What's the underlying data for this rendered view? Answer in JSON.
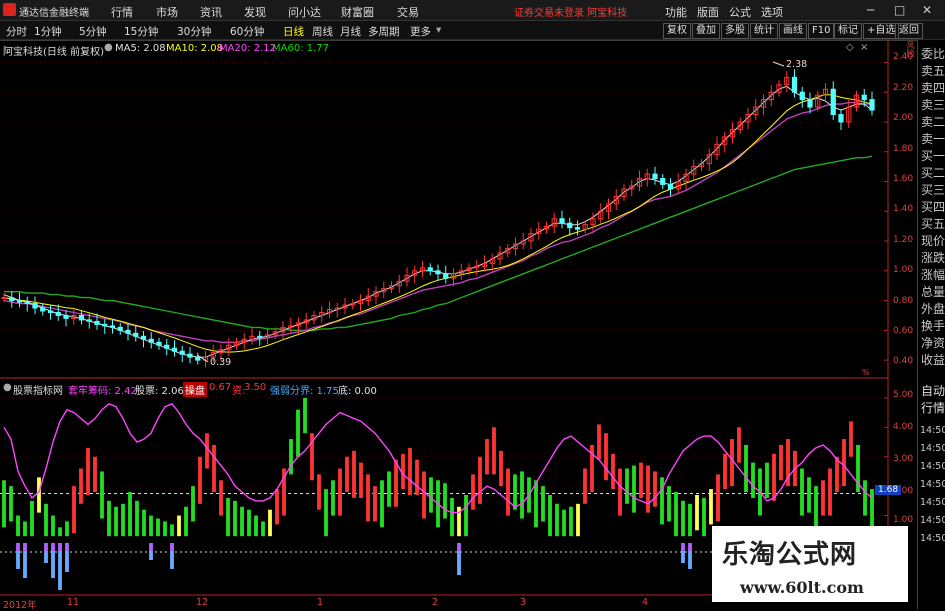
{
  "menubar": {
    "app_title": "通达信金融终端",
    "items": [
      "行情",
      "市场",
      "资讯",
      "发现",
      "问小达",
      "财富圈",
      "交易"
    ],
    "warning": "证券交易未登录  阿宝科技",
    "right_items": [
      "功能",
      "版面",
      "公式",
      "选项"
    ],
    "win_controls": [
      "─",
      "□",
      "✕"
    ]
  },
  "toolbar": {
    "timeframes": [
      "分时",
      "1分钟",
      "5分钟",
      "15分钟",
      "30分钟",
      "60分钟",
      "日线",
      "周线",
      "月线",
      "多周期",
      "更多"
    ],
    "active_timeframe": "日线",
    "right_buttons": [
      "复权",
      "叠加",
      "多股",
      "统计",
      "画线",
      "F10",
      "标记",
      "+自选",
      "返回"
    ]
  },
  "main_chart": {
    "stock_label": "阿宝科技(日线 前复权)",
    "ma": [
      {
        "label": "MA5: 2.08",
        "color": "#e0e0e0"
      },
      {
        "label": "MA10: 2.08",
        "color": "#ffff00"
      },
      {
        "label": "MA20: 2.12",
        "color": "#ff44ff"
      },
      {
        "label": "MA60: 1.77",
        "color": "#00dd00"
      }
    ],
    "high_annotation": "2.38",
    "low_annotation": "0.39",
    "y_ticks": [
      "2.40",
      "2.20",
      "2.00",
      "1.80",
      "1.60",
      "1.40",
      "1.20",
      "1.00",
      "0.80",
      "0.60",
      "0.40"
    ],
    "top_right_label": "风险",
    "scale_label": "%"
  },
  "chart_data": {
    "type": "candlestick",
    "ylim": [
      0.3,
      2.45
    ],
    "close_series": [
      0.82,
      0.8,
      0.79,
      0.78,
      0.75,
      0.73,
      0.72,
      0.7,
      0.68,
      0.7,
      0.67,
      0.66,
      0.64,
      0.63,
      0.62,
      0.6,
      0.58,
      0.56,
      0.54,
      0.52,
      0.5,
      0.48,
      0.46,
      0.44,
      0.42,
      0.4,
      0.42,
      0.45,
      0.47,
      0.5,
      0.52,
      0.54,
      0.56,
      0.55,
      0.57,
      0.59,
      0.62,
      0.63,
      0.65,
      0.67,
      0.7,
      0.72,
      0.74,
      0.75,
      0.77,
      0.78,
      0.8,
      0.83,
      0.86,
      0.88,
      0.9,
      0.93,
      0.97,
      1.0,
      1.02,
      1.0,
      0.98,
      0.95,
      0.98,
      1.0,
      1.02,
      1.03,
      1.05,
      1.08,
      1.12,
      1.15,
      1.18,
      1.2,
      1.25,
      1.28,
      1.3,
      1.35,
      1.32,
      1.29,
      1.28,
      1.31,
      1.35,
      1.4,
      1.45,
      1.5,
      1.55,
      1.57,
      1.62,
      1.65,
      1.62,
      1.58,
      1.55,
      1.6,
      1.65,
      1.7,
      1.72,
      1.78,
      1.85,
      1.9,
      1.95,
      2.0,
      2.05,
      2.1,
      2.15,
      2.2,
      2.25,
      2.3,
      2.2,
      2.15,
      2.1,
      2.18,
      2.22,
      2.05,
      2.0,
      2.1,
      2.18,
      2.15,
      2.08
    ],
    "ma5": [
      0.84,
      0.82,
      0.8,
      0.79,
      0.77,
      0.75,
      0.73,
      0.71,
      0.7,
      0.69,
      0.68,
      0.66,
      0.65,
      0.63,
      0.62,
      0.6,
      0.58,
      0.56,
      0.54,
      0.52,
      0.5,
      0.48,
      0.46,
      0.44,
      0.43,
      0.42,
      0.42,
      0.44,
      0.46,
      0.48,
      0.5,
      0.52,
      0.54,
      0.55,
      0.56,
      0.58,
      0.6,
      0.62,
      0.64,
      0.66,
      0.68,
      0.7,
      0.72,
      0.74,
      0.76,
      0.78,
      0.8,
      0.82,
      0.85,
      0.87,
      0.89,
      0.92,
      0.95,
      0.98,
      1.0,
      1.0,
      0.99,
      0.98,
      0.98,
      0.99,
      1.01,
      1.03,
      1.05,
      1.08,
      1.11,
      1.14,
      1.17,
      1.2,
      1.23,
      1.26,
      1.29,
      1.32,
      1.32,
      1.31,
      1.31,
      1.33,
      1.36,
      1.4,
      1.44,
      1.48,
      1.53,
      1.56,
      1.6,
      1.62,
      1.61,
      1.59,
      1.58,
      1.6,
      1.64,
      1.68,
      1.72,
      1.77,
      1.82,
      1.88,
      1.93,
      1.98,
      2.03,
      2.08,
      2.13,
      2.18,
      2.22,
      2.24,
      2.2,
      2.17,
      2.15,
      2.16,
      2.14,
      2.1,
      2.08,
      2.1,
      2.12,
      2.12,
      2.08
    ],
    "ma20": [
      0.8,
      0.79,
      0.78,
      0.78,
      0.77,
      0.76,
      0.75,
      0.74,
      0.73,
      0.72,
      0.71,
      0.7,
      0.69,
      0.68,
      0.67,
      0.66,
      0.64,
      0.63,
      0.62,
      0.6,
      0.59,
      0.58,
      0.57,
      0.56,
      0.55,
      0.54,
      0.53,
      0.53,
      0.52,
      0.52,
      0.52,
      0.53,
      0.53,
      0.54,
      0.55,
      0.56,
      0.57,
      0.58,
      0.59,
      0.6,
      0.62,
      0.63,
      0.65,
      0.66,
      0.68,
      0.7,
      0.71,
      0.73,
      0.75,
      0.77,
      0.79,
      0.81,
      0.83,
      0.85,
      0.87,
      0.88,
      0.89,
      0.9,
      0.91,
      0.92,
      0.94,
      0.95,
      0.97,
      0.99,
      1.01,
      1.03,
      1.05,
      1.07,
      1.1,
      1.12,
      1.15,
      1.17,
      1.19,
      1.2,
      1.22,
      1.24,
      1.26,
      1.29,
      1.31,
      1.34,
      1.37,
      1.4,
      1.43,
      1.46,
      1.48,
      1.49,
      1.5,
      1.52,
      1.54,
      1.57,
      1.6,
      1.63,
      1.66,
      1.7,
      1.74,
      1.78,
      1.82,
      1.86,
      1.9,
      1.94,
      1.98,
      2.02,
      2.04,
      2.06,
      2.07,
      2.09,
      2.11,
      2.12,
      2.12,
      2.13,
      2.13,
      2.12,
      2.12
    ],
    "ma60": [
      0.86,
      0.86,
      0.86,
      0.85,
      0.85,
      0.85,
      0.84,
      0.84,
      0.83,
      0.83,
      0.82,
      0.82,
      0.81,
      0.8,
      0.8,
      0.79,
      0.78,
      0.77,
      0.76,
      0.75,
      0.74,
      0.73,
      0.72,
      0.71,
      0.7,
      0.69,
      0.68,
      0.67,
      0.66,
      0.65,
      0.64,
      0.63,
      0.62,
      0.62,
      0.61,
      0.61,
      0.61,
      0.6,
      0.6,
      0.6,
      0.6,
      0.61,
      0.61,
      0.62,
      0.62,
      0.63,
      0.64,
      0.65,
      0.66,
      0.67,
      0.68,
      0.7,
      0.71,
      0.72,
      0.74,
      0.75,
      0.77,
      0.78,
      0.8,
      0.82,
      0.84,
      0.86,
      0.88,
      0.9,
      0.92,
      0.94,
      0.96,
      0.98,
      1.0,
      1.02,
      1.04,
      1.06,
      1.08,
      1.1,
      1.12,
      1.14,
      1.16,
      1.18,
      1.2,
      1.22,
      1.24,
      1.26,
      1.28,
      1.3,
      1.32,
      1.34,
      1.36,
      1.38,
      1.4,
      1.42,
      1.44,
      1.46,
      1.48,
      1.5,
      1.52,
      1.54,
      1.56,
      1.58,
      1.6,
      1.62,
      1.64,
      1.66,
      1.68,
      1.69,
      1.7,
      1.71,
      1.72,
      1.73,
      1.74,
      1.75,
      1.76,
      1.76,
      1.77
    ]
  },
  "indicator": {
    "name": "股票指标网",
    "items": [
      {
        "label": "套牢筹码: 2.42",
        "color": "#ff44ff"
      },
      {
        "label": "股票: 2.06",
        "color": "#e0e0e0"
      },
      {
        "label": "操盘",
        "color": "#ff3333"
      },
      {
        "label": "0.67",
        "color": "#ff3333"
      },
      {
        "label": "资:",
        "color": "#ff3333"
      },
      {
        "label": "3.50",
        "color": "#ff3333"
      },
      {
        "label": "强弱分界: 1.75",
        "color": "#44aaff"
      },
      {
        "label": "底: 0.00",
        "color": "#e0e0e0"
      }
    ],
    "y_ticks": [
      "5.00",
      "4.00",
      "3.00",
      "2.00",
      "1.00"
    ],
    "current_value": "1.68",
    "hist": [
      2.2,
      2.0,
      1.0,
      0.8,
      1.5,
      2.3,
      1.4,
      1.0,
      0.6,
      0.8,
      2.0,
      2.6,
      3.3,
      3.0,
      2.5,
      1.5,
      1.3,
      1.4,
      1.8,
      1.5,
      1.2,
      1.0,
      0.9,
      0.8,
      0.7,
      1.0,
      1.3,
      2.0,
      3.0,
      3.8,
      3.4,
      2.2,
      1.6,
      1.5,
      1.3,
      1.2,
      1.0,
      0.8,
      1.2,
      1.9,
      2.6,
      3.6,
      4.6,
      5.0,
      3.8,
      2.4,
      1.9,
      2.2,
      2.6,
      3.0,
      3.2,
      2.8,
      2.4,
      2.0,
      2.2,
      2.5,
      2.9,
      3.1,
      3.3,
      2.9,
      2.5,
      2.3,
      2.2,
      2.1,
      1.6,
      1.3,
      1.7,
      2.4,
      3.0,
      3.6,
      4.0,
      3.2,
      2.6,
      2.4,
      2.5,
      2.3,
      2.2,
      2.0,
      1.7,
      1.4,
      1.2,
      1.3,
      1.4,
      2.6,
      3.4,
      4.1,
      3.8,
      3.1,
      2.6,
      2.6,
      2.7,
      2.8,
      2.7,
      2.5,
      2.3,
      2.0,
      1.8,
      1.5,
      1.4,
      1.7,
      1.6,
      1.9,
      2.4,
      3.1,
      3.6,
      4.0,
      3.4,
      2.8,
      2.6,
      2.8,
      3.1,
      3.4,
      3.6,
      3.2,
      2.6,
      2.3,
      2.0,
      2.2,
      2.6,
      3.0,
      3.6,
      4.2,
      3.4,
      2.2,
      1.9
    ],
    "hist_color": [
      "g",
      "g",
      "g",
      "g",
      "g",
      "y",
      "g",
      "g",
      "g",
      "g",
      "r",
      "r",
      "r",
      "r",
      "g",
      "g",
      "g",
      "g",
      "g",
      "g",
      "g",
      "g",
      "g",
      "g",
      "g",
      "y",
      "g",
      "g",
      "r",
      "r",
      "r",
      "r",
      "g",
      "g",
      "g",
      "g",
      "g",
      "g",
      "y",
      "r",
      "r",
      "g",
      "g",
      "g",
      "r",
      "r",
      "g",
      "g",
      "r",
      "r",
      "r",
      "r",
      "r",
      "r",
      "g",
      "g",
      "r",
      "r",
      "r",
      "r",
      "r",
      "g",
      "g",
      "g",
      "g",
      "y",
      "g",
      "r",
      "r",
      "r",
      "r",
      "r",
      "r",
      "g",
      "g",
      "g",
      "g",
      "g",
      "g",
      "g",
      "g",
      "g",
      "y",
      "r",
      "r",
      "r",
      "r",
      "r",
      "r",
      "g",
      "g",
      "r",
      "r",
      "r",
      "g",
      "g",
      "g",
      "g",
      "g",
      "y",
      "g",
      "y",
      "r",
      "r",
      "r",
      "r",
      "g",
      "g",
      "g",
      "g",
      "r",
      "r",
      "r",
      "r",
      "g",
      "g",
      "g",
      "r",
      "r",
      "r",
      "r",
      "r",
      "g",
      "g",
      "g"
    ],
    "blue_ext": [
      0,
      0,
      0.6,
      0.9,
      0,
      0,
      0.4,
      0.9,
      1.3,
      0.7,
      0,
      0,
      0,
      0,
      0,
      0,
      0,
      0,
      0,
      0,
      0,
      0.3,
      0,
      0,
      0.6,
      0,
      0,
      0,
      0,
      0,
      0,
      0,
      0,
      0,
      0,
      0,
      0,
      0,
      0,
      0,
      0,
      0,
      0,
      0,
      0,
      0,
      0,
      0,
      0,
      0,
      0,
      0,
      0,
      0,
      0,
      0,
      0,
      0,
      0,
      0,
      0,
      0,
      0,
      0,
      0,
      0.8,
      0,
      0,
      0,
      0,
      0,
      0,
      0,
      0,
      0,
      0,
      0,
      0,
      0,
      0,
      0,
      0,
      0,
      0,
      0,
      0,
      0,
      0,
      0,
      0,
      0,
      0,
      0,
      0,
      0,
      0,
      0,
      0.4,
      0.6,
      0,
      0,
      0,
      0,
      0,
      0,
      0,
      0,
      0,
      0,
      0,
      0,
      0,
      0,
      0,
      0,
      0,
      0,
      0,
      0,
      0,
      0,
      0,
      0
    ],
    "magenta_line": [
      4.0,
      3.6,
      2.5,
      2.0,
      1.6,
      1.8,
      2.6,
      3.5,
      4.2,
      4.6,
      4.5,
      4.3,
      4.1,
      4.3,
      4.6,
      4.8,
      4.7,
      4.3,
      3.8,
      3.5,
      3.6,
      3.8,
      4.3,
      4.7,
      4.8,
      4.5,
      4.1,
      3.8,
      3.6,
      3.3,
      3.0,
      2.7,
      2.4,
      2.0,
      1.8,
      1.6,
      1.5,
      1.5,
      1.6,
      1.9,
      2.3,
      2.7,
      3.0,
      3.2,
      3.5,
      3.8,
      4.1,
      4.3,
      4.5,
      4.4,
      4.3,
      4.2,
      4.0,
      3.8,
      3.5,
      3.2,
      2.8,
      2.4,
      2.2,
      2.0,
      1.8,
      1.6,
      1.4,
      1.2,
      1.1,
      1.1,
      1.3,
      1.6,
      1.8,
      2.0,
      1.9,
      1.7,
      1.5,
      1.3,
      1.4,
      1.7,
      2.1,
      2.5,
      2.9,
      3.3,
      3.6,
      3.7,
      3.5,
      3.3,
      3.1,
      2.9,
      2.6,
      2.3,
      2.0,
      1.8,
      1.6,
      1.5,
      1.4,
      1.6,
      1.9,
      2.4,
      2.8,
      3.2,
      3.4,
      3.6,
      3.7,
      3.7,
      3.5,
      3.2,
      2.9,
      2.6,
      2.3,
      2.0,
      1.8,
      1.5,
      1.6,
      1.9,
      2.3,
      2.6,
      2.8,
      3.1,
      3.3,
      3.4,
      3.2,
      2.9,
      2.7,
      2.4,
      2.1,
      1.8,
      1.6
    ],
    "dashed_line_value": 0.0
  },
  "right_panel": {
    "items": [
      "委比",
      "卖五",
      "卖四",
      "卖三",
      "卖二",
      "卖一",
      "买一",
      "买二",
      "买三",
      "买四",
      "买五",
      "现价",
      "涨跌",
      "涨幅",
      "总量",
      "外盘",
      "换手",
      "净资",
      "收益"
    ],
    "lower_items": [
      "自动",
      "行情"
    ],
    "times": [
      "14:50",
      "14:50",
      "14:50",
      "14:50",
      "14:50",
      "14:50",
      "14:50"
    ]
  },
  "x_axis": {
    "labels": [
      "2012年",
      "11",
      "12",
      "1",
      "2",
      "3",
      "4"
    ]
  },
  "watermark": {
    "title": "乐淘公式网",
    "url": "www.60lt.com"
  },
  "colors": {
    "up": "#ff3333",
    "down": "#54ffff",
    "ma5": "#e0e0e0",
    "ma10": "#ffff00",
    "ma20": "#c040c0",
    "ma60": "#22aa22",
    "hist_green": "#22dd22",
    "hist_red": "#ff3333",
    "hist_yellow": "#ffff55",
    "hist_blue": "#66aaff",
    "magenta": "#ff44ff"
  }
}
